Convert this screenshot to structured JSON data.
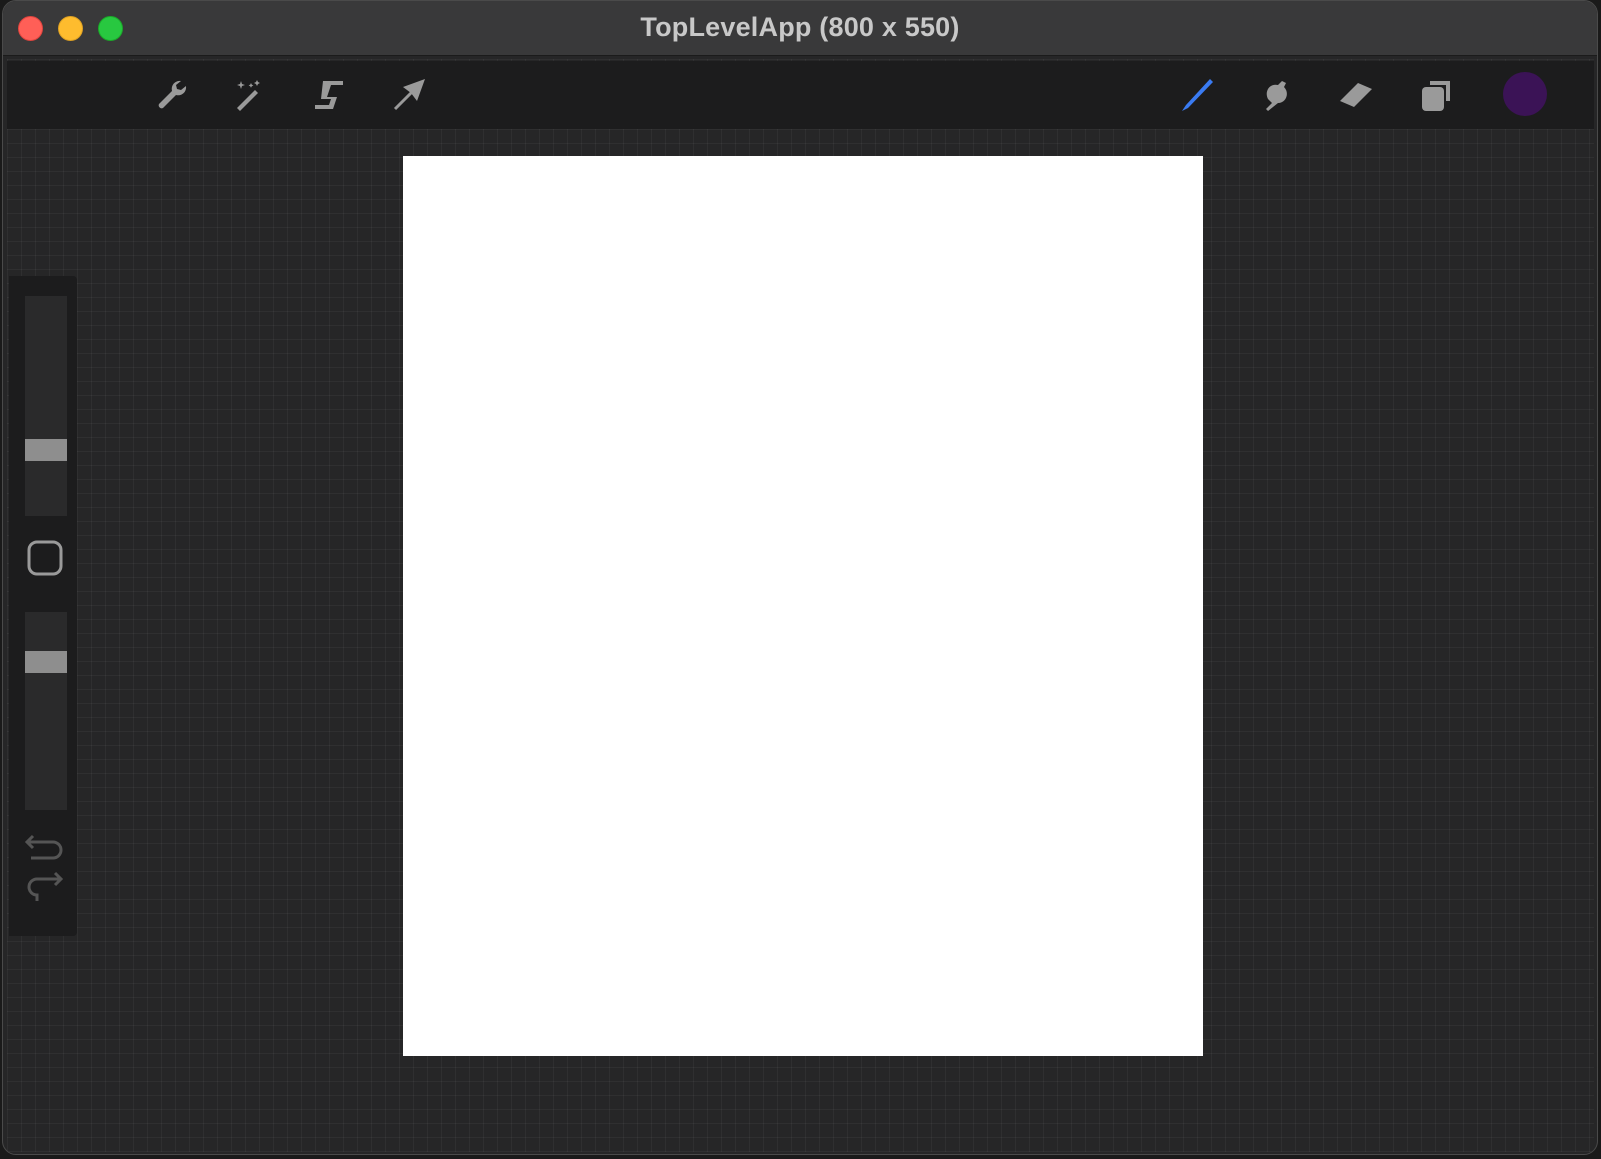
{
  "window": {
    "title": "TopLevelApp (800 x 550)"
  },
  "toolbar": {
    "left_tools": [
      {
        "name": "actions",
        "icon": "wrench-icon"
      },
      {
        "name": "adjustments",
        "icon": "magic-wand-icon"
      },
      {
        "name": "selection",
        "icon": "selection-s-icon"
      },
      {
        "name": "transform",
        "icon": "arrow-cursor-icon"
      }
    ],
    "right_tools": [
      {
        "name": "brush",
        "icon": "brush-icon",
        "active": true
      },
      {
        "name": "smudge",
        "icon": "smudge-icon",
        "active": false
      },
      {
        "name": "eraser",
        "icon": "eraser-icon",
        "active": false
      },
      {
        "name": "layers",
        "icon": "layers-icon",
        "active": false
      }
    ],
    "current_color": "#3b1356"
  },
  "sidebar": {
    "brush_size_level": 0.28,
    "opacity_level": 0.78,
    "icons": [
      "modify-square-icon",
      "undo-icon",
      "redo-icon"
    ]
  },
  "colors": {
    "active_tool": "#3a7bf2",
    "inactive_tool": "#9a9a9a",
    "canvas": "#ffffff"
  }
}
